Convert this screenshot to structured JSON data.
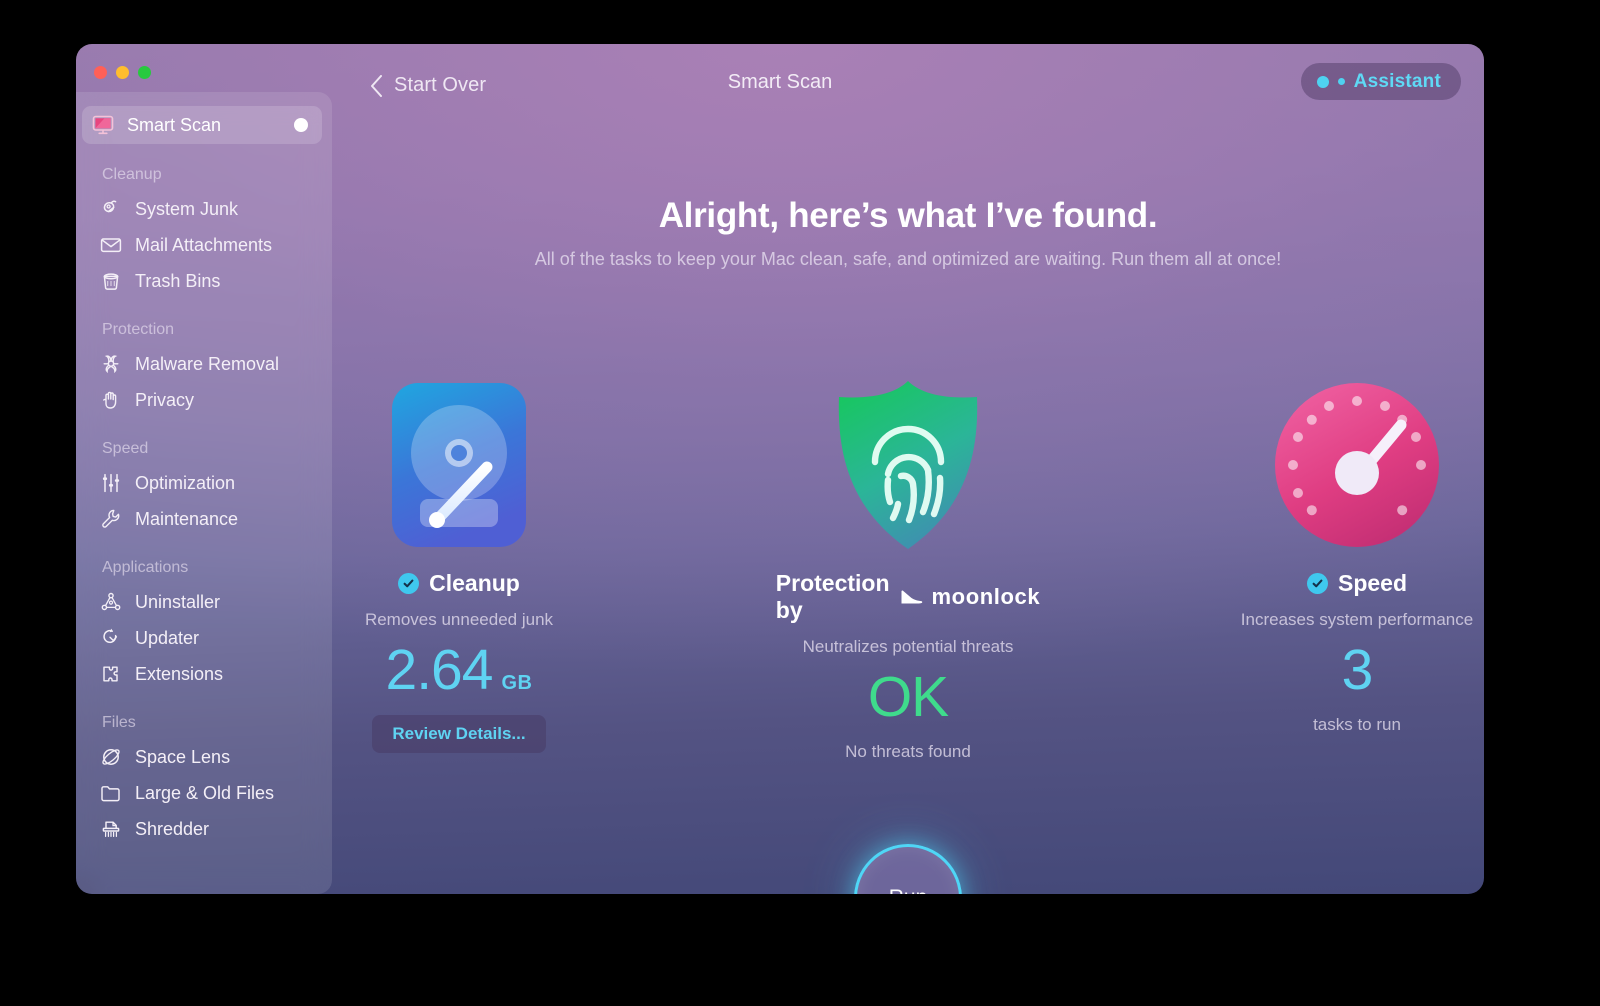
{
  "window": {
    "title": "Smart Scan",
    "back_label": "Start Over",
    "assistant_label": "Assistant",
    "traffic_lights": [
      "close-button",
      "minimize-button",
      "zoom-button"
    ]
  },
  "sidebar": {
    "active_item": {
      "label": "Smart Scan",
      "icon": "smart-scan-icon",
      "status": "ready-dot"
    },
    "groups": [
      {
        "label": "Cleanup",
        "items": [
          {
            "label": "System Junk",
            "icon": "broom-icon"
          },
          {
            "label": "Mail Attachments",
            "icon": "envelope-icon"
          },
          {
            "label": "Trash Bins",
            "icon": "trash-icon"
          }
        ]
      },
      {
        "label": "Protection",
        "items": [
          {
            "label": "Malware Removal",
            "icon": "biohazard-icon"
          },
          {
            "label": "Privacy",
            "icon": "hand-icon"
          }
        ]
      },
      {
        "label": "Speed",
        "items": [
          {
            "label": "Optimization",
            "icon": "sliders-icon"
          },
          {
            "label": "Maintenance",
            "icon": "wrench-icon"
          }
        ]
      },
      {
        "label": "Applications",
        "items": [
          {
            "label": "Uninstaller",
            "icon": "molecule-icon"
          },
          {
            "label": "Updater",
            "icon": "refresh-arrow-icon"
          },
          {
            "label": "Extensions",
            "icon": "puzzle-piece-icon"
          }
        ]
      },
      {
        "label": "Files",
        "items": [
          {
            "label": "Space Lens",
            "icon": "planet-icon"
          },
          {
            "label": "Large & Old Files",
            "icon": "folder-icon"
          },
          {
            "label": "Shredder",
            "icon": "shredder-icon"
          }
        ]
      }
    ]
  },
  "main": {
    "headline": "Alright, here’s what I’ve found.",
    "subhead": "All of the tasks to keep your Mac clean, safe, and optimized are waiting. Run them all at once!",
    "run_label": "Run",
    "cards": [
      {
        "id": "cleanup",
        "icon": "hard-disk-icon",
        "title": "Cleanup",
        "checked": true,
        "description": "Removes unneeded junk",
        "value": "2.64",
        "unit": "GB",
        "value_color": "#5fd3f2",
        "action_label": "Review Details..."
      },
      {
        "id": "protection",
        "icon": "shield-fingerprint-icon",
        "title": "Protection by",
        "brand": "moonlock",
        "brand_icon": "moonlock-logo-icon",
        "checked": false,
        "description": "Neutralizes potential threats",
        "value": "OK",
        "unit": "",
        "value_color": "#3fdb8c",
        "note": "No threats found"
      },
      {
        "id": "speed",
        "icon": "speedometer-icon",
        "title": "Speed",
        "checked": true,
        "description": "Increases system performance",
        "value": "3",
        "unit": "",
        "value_color": "#5fd3f2",
        "note": "tasks to run"
      }
    ]
  },
  "colors": {
    "accent_cyan": "#5fd3f2",
    "accent_green": "#3fdb8c",
    "bg_top": "#9d7fae",
    "bg_bottom": "#434878",
    "assistant_text": "#5fd9f5"
  }
}
